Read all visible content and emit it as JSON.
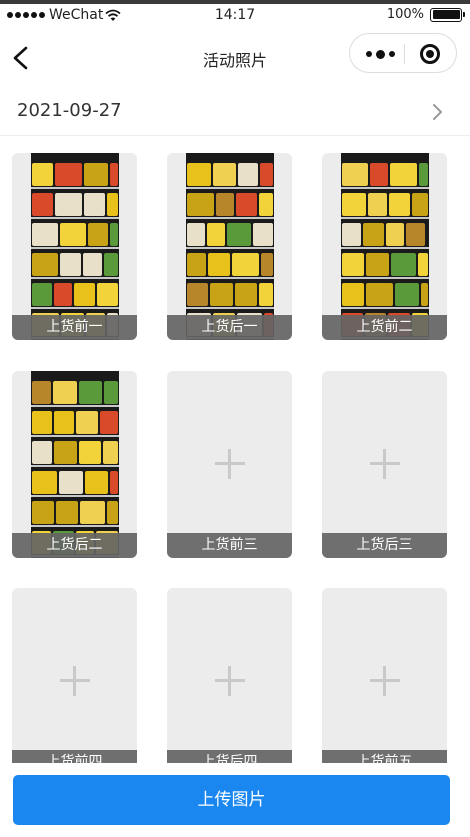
{
  "status_bar": {
    "carrier": "WeChat",
    "time": "14:17",
    "battery": "100%"
  },
  "nav": {
    "title": "活动照片"
  },
  "date": "2021-09-27",
  "photos": [
    {
      "label": "上货前一",
      "has_photo": true
    },
    {
      "label": "上货后一",
      "has_photo": true
    },
    {
      "label": "上货前二",
      "has_photo": true
    },
    {
      "label": "上货后二",
      "has_photo": true
    },
    {
      "label": "上货前三",
      "has_photo": false
    },
    {
      "label": "上货后三",
      "has_photo": false
    },
    {
      "label": "上货前四",
      "has_photo": false
    },
    {
      "label": "上货后四",
      "has_photo": false
    },
    {
      "label": "上货前五",
      "has_photo": false
    }
  ],
  "upload_button": "上传图片",
  "colors": {
    "primary": "#1a87f0",
    "tile": "#ececec",
    "caption": "#646464"
  }
}
